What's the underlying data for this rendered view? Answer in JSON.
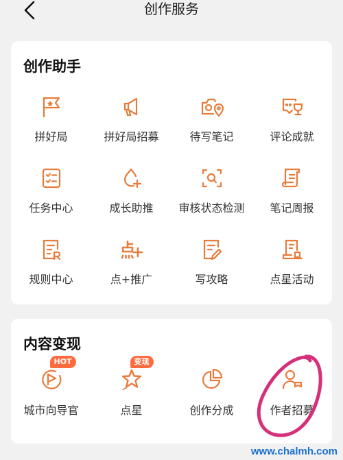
{
  "header": {
    "title": "创作服务",
    "back_icon": "chevron-left-icon"
  },
  "assistant": {
    "title": "创作助手",
    "items": [
      {
        "label": "拼好局",
        "icon": "flag-star-icon"
      },
      {
        "label": "拼好局招募",
        "icon": "megaphone-icon"
      },
      {
        "label": "待写笔记",
        "icon": "camera-location-icon"
      },
      {
        "label": "评论成就",
        "icon": "chat-trophy-icon"
      },
      {
        "label": "任务中心",
        "icon": "checklist-icon"
      },
      {
        "label": "成长助推",
        "icon": "drop-plus-icon"
      },
      {
        "label": "审核状态检测",
        "icon": "scan-search-icon"
      },
      {
        "label": "笔记周报",
        "icon": "scroll-icon"
      },
      {
        "label": "规则中心",
        "icon": "rule-doc-icon"
      },
      {
        "label": "点+推广",
        "icon": "dian-plus-icon"
      },
      {
        "label": "写攻略",
        "icon": "write-doc-icon"
      },
      {
        "label": "点星活动",
        "icon": "star-doc-icon"
      }
    ]
  },
  "monetize": {
    "title": "内容变现",
    "items": [
      {
        "label": "城市向导官",
        "icon": "guide-flag-icon",
        "badge": "HOT"
      },
      {
        "label": "点星",
        "icon": "star-icon",
        "badge": "变现"
      },
      {
        "label": "创作分成",
        "icon": "pie-chart-icon"
      },
      {
        "label": "作者招募",
        "icon": "author-recruit-icon"
      }
    ]
  },
  "watermark": "www.chalmh.com",
  "colors": {
    "accent": "#e87a3a",
    "badge": "#ff6b3d",
    "circle": "#d6307a"
  }
}
